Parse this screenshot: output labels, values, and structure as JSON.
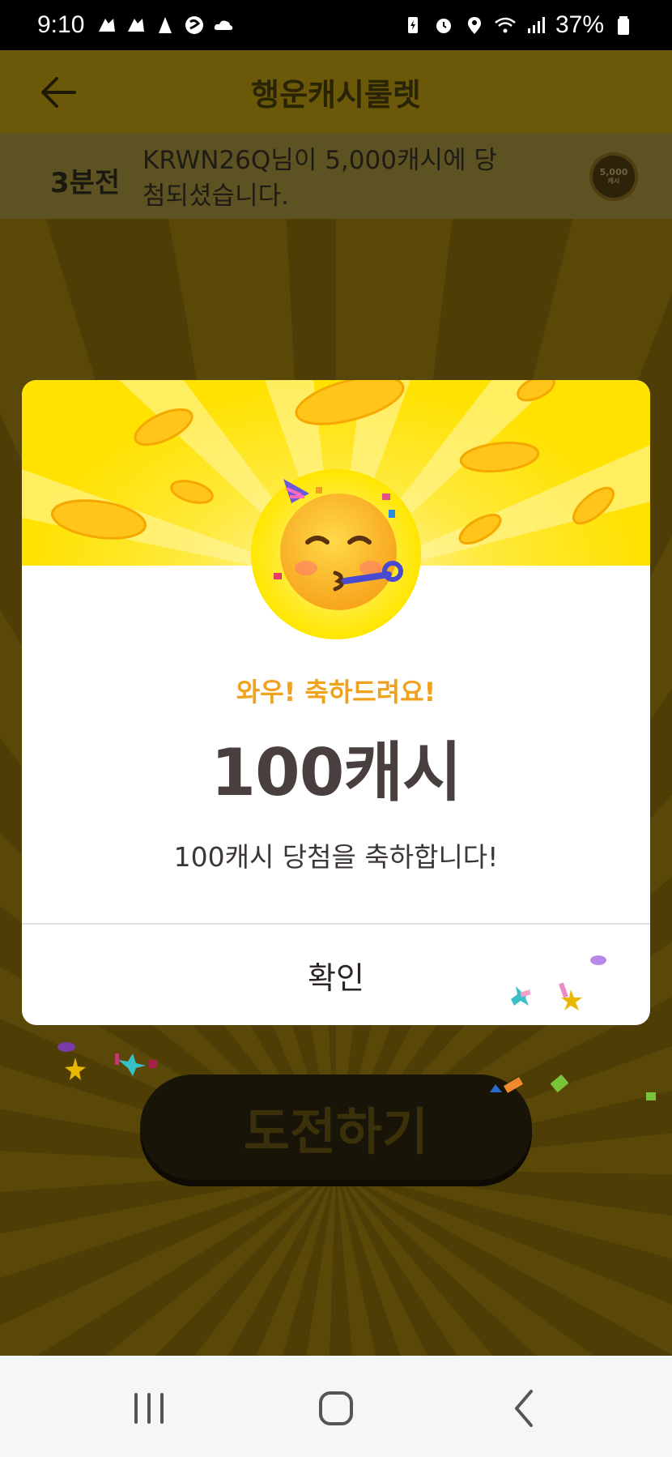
{
  "status_bar": {
    "time": "9:10",
    "battery": "37%",
    "left_icons": [
      "notification-app-icon",
      "notification-app-icon",
      "notification-app-icon",
      "swirl-app-icon",
      "cloud-icon"
    ],
    "right_icons": [
      "battery-saver-icon",
      "alarm-icon",
      "location-icon",
      "wifi-icon",
      "signal-icon",
      "battery-icon"
    ]
  },
  "header": {
    "title": "행운캐시룰렛",
    "back_icon": "arrow-left-icon"
  },
  "ticker": {
    "time_ago": "3분전",
    "message": "KRWN26Q님이 5,000캐시에 당첨되셨습니다.",
    "badge_amount": "5,000",
    "badge_unit": "캐시"
  },
  "challenge_button": {
    "label": "도전하기"
  },
  "modal": {
    "headline": "와우! 축하드려요!",
    "amount": "100캐시",
    "message": "100캐시 당첨을 축하합니다!",
    "confirm_label": "확인",
    "emoji": "partying-face-icon"
  },
  "colors": {
    "accent_yellow": "#ffe200",
    "headline_orange": "#f0a21e",
    "amount_text": "#4a3f3f"
  },
  "nav_bar": {
    "buttons": [
      "recent-apps-icon",
      "home-icon",
      "back-icon"
    ]
  }
}
